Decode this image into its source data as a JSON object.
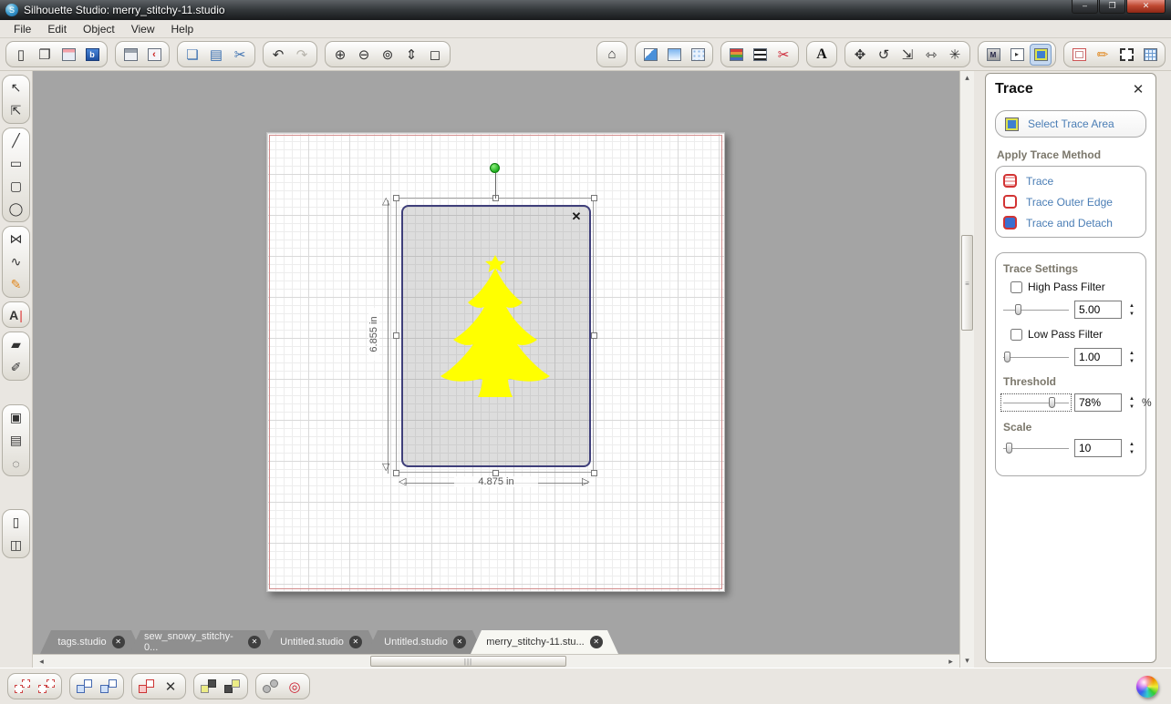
{
  "window": {
    "title": "Silhouette Studio: merry_stitchy-11.studio",
    "logo": "S",
    "controls": {
      "minimize": "–",
      "restore": "❐",
      "close": "✕"
    }
  },
  "menu": {
    "items": [
      "File",
      "Edit",
      "Object",
      "View",
      "Help"
    ]
  },
  "icons": {
    "new": "▯",
    "open": "❐",
    "library_letter": "b",
    "cutter_glyph": "‹",
    "copy": "❏",
    "paste": "▤",
    "cut": "✂",
    "undo": "↶",
    "redo": "↷",
    "zoom_in": "⊕",
    "zoom_out": "⊖",
    "zoom_selection": "⊚",
    "pan": "⇕",
    "fit_page": "◻",
    "home": "⌂",
    "cut_style": "✂",
    "text_style": "A",
    "move": "✥",
    "rotate": "↺",
    "scale": "⇲",
    "align": "⇿",
    "modify": "✳",
    "library_m": "M",
    "page_arrow": "▸",
    "sketch_pen": "✏",
    "select": "↖",
    "edit_points": "⇱",
    "line": "╱",
    "rectangle": "▭",
    "rounded_rectangle": "▢",
    "ellipse": "◯",
    "polygon": "⋈",
    "curve": "∿",
    "freehand": "✎",
    "text_tool": "A",
    "eraser": "▰",
    "knife": "✐",
    "shape_select": "▣",
    "notes": "▤",
    "lasso": "◌",
    "page_single": "▯",
    "page_split": "◫",
    "delete": "✕",
    "offset": "◎",
    "tab_close": "✕",
    "trace_close": "✕",
    "panel_close": "✕",
    "scroll_left": "◂",
    "scroll_right": "▸",
    "scroll_up": "▴",
    "scroll_down": "▾",
    "thumb_grip_h": "|||",
    "thumb_grip_v": "≡",
    "spin_up": "▲",
    "spin_down": "▼",
    "arrow_up": "△",
    "arrow_down": "▽",
    "arrow_left": "◁",
    "arrow_right": "▷"
  },
  "canvas": {
    "height_label": "6.855 in",
    "width_label": "4.875 in"
  },
  "tabs": {
    "items": [
      {
        "label": "tags.studio",
        "active": false
      },
      {
        "label": "sew_snowy_stitchy-0...",
        "active": false
      },
      {
        "label": "Untitled.studio",
        "active": false
      },
      {
        "label": "Untitled.studio",
        "active": false
      },
      {
        "label": "merry_stitchy-11.stu...",
        "active": true
      }
    ]
  },
  "trace_panel": {
    "title": "Trace",
    "select_trace_area": "Select Trace Area",
    "apply_trace_method": "Apply Trace Method",
    "methods": [
      {
        "label": "Trace"
      },
      {
        "label": "Trace Outer Edge"
      },
      {
        "label": "Trace and Detach"
      }
    ],
    "settings_title": "Trace Settings",
    "high_pass": {
      "label": "High Pass Filter",
      "value": "5.00",
      "checked": false
    },
    "low_pass": {
      "label": "Low Pass Filter",
      "value": "1.00",
      "checked": false
    },
    "threshold": {
      "label": "Threshold",
      "value": "78%",
      "unit": "%"
    },
    "scale": {
      "label": "Scale",
      "value": "10"
    }
  },
  "colors": {
    "tree_fill": "#ffff00",
    "selection_border": "#3f3f7a",
    "accent_blue": "#4a7db5",
    "mat_red": "#d28c8c",
    "trace_active_highlight": "#dde24e",
    "rotation_handle_green": "#1fae1f"
  }
}
